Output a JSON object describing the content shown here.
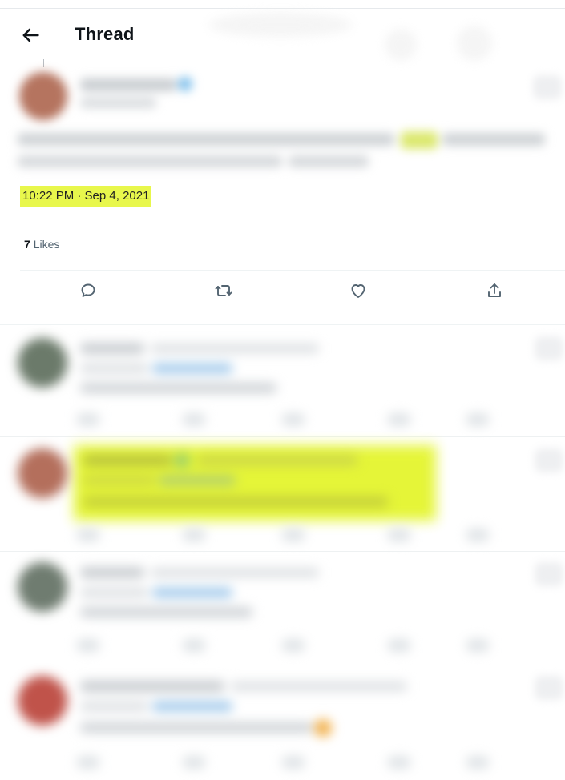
{
  "header": {
    "title": "Thread",
    "back_icon": "arrow-left-icon"
  },
  "tweet": {
    "timestamp": "10:22 PM · Sep 4, 2021",
    "likes_count": "7",
    "likes_label": "Likes",
    "highlight_color": "#e8f74c",
    "actions": [
      {
        "name": "reply",
        "icon": "comment-icon"
      },
      {
        "name": "retweet",
        "icon": "retweet-icon"
      },
      {
        "name": "like",
        "icon": "heart-icon"
      },
      {
        "name": "share",
        "icon": "share-icon"
      }
    ]
  },
  "replies": [
    {
      "avatar_color": "#6b7a6a"
    },
    {
      "avatar_color": "#b46f5c",
      "highlighted": true
    },
    {
      "avatar_color": "#6f7c70"
    },
    {
      "avatar_color": "#c0534a"
    }
  ]
}
